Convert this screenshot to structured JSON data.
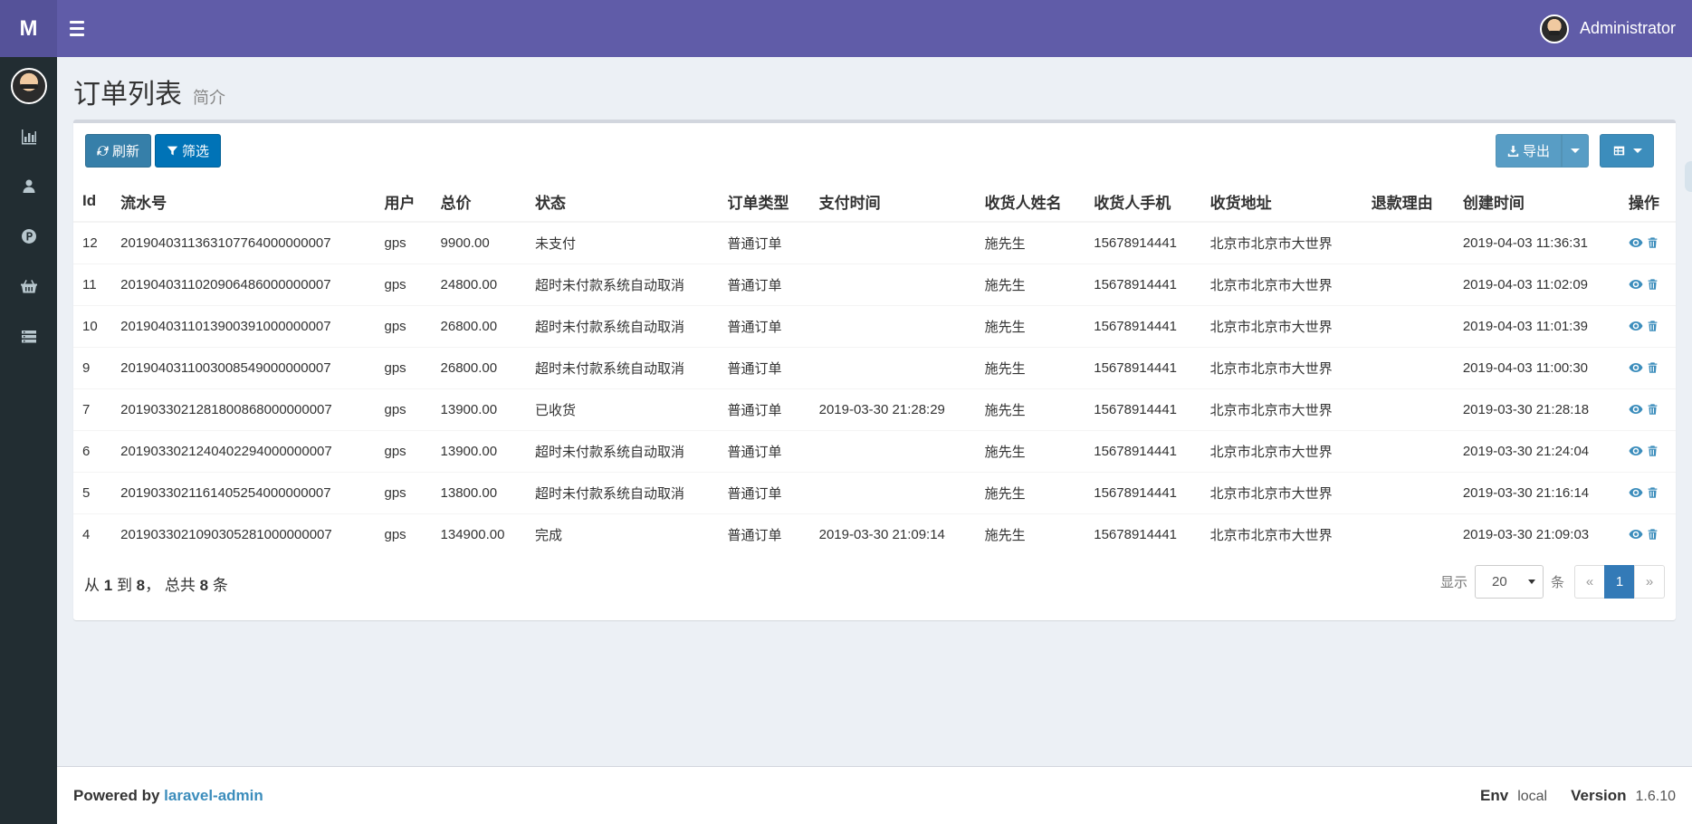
{
  "logo": "M",
  "header": {
    "user_name": "Administrator"
  },
  "page": {
    "title": "订单列表",
    "subtitle": "简介"
  },
  "toolbar": {
    "refresh_label": "刷新",
    "filter_label": "筛选",
    "export_label": "导出"
  },
  "table": {
    "columns": [
      "Id",
      "流水号",
      "用户",
      "总价",
      "状态",
      "订单类型",
      "支付时间",
      "收货人姓名",
      "收货人手机",
      "收货地址",
      "退款理由",
      "创建时间",
      "操作"
    ],
    "rows": [
      [
        "12",
        "2019040311363107764000000007",
        "gps",
        "9900.00",
        "未支付",
        "普通订单",
        "",
        "施先生",
        "15678914441",
        "北京市北京市大世界",
        "",
        "2019-04-03 11:36:31"
      ],
      [
        "11",
        "2019040311020906486000000007",
        "gps",
        "24800.00",
        "超时未付款系统自动取消",
        "普通订单",
        "",
        "施先生",
        "15678914441",
        "北京市北京市大世界",
        "",
        "2019-04-03 11:02:09"
      ],
      [
        "10",
        "2019040311013900391000000007",
        "gps",
        "26800.00",
        "超时未付款系统自动取消",
        "普通订单",
        "",
        "施先生",
        "15678914441",
        "北京市北京市大世界",
        "",
        "2019-04-03 11:01:39"
      ],
      [
        "9",
        "2019040311003008549000000007",
        "gps",
        "26800.00",
        "超时未付款系统自动取消",
        "普通订单",
        "",
        "施先生",
        "15678914441",
        "北京市北京市大世界",
        "",
        "2019-04-03 11:00:30"
      ],
      [
        "7",
        "2019033021281800868000000007",
        "gps",
        "13900.00",
        "已收货",
        "普通订单",
        "2019-03-30 21:28:29",
        "施先生",
        "15678914441",
        "北京市北京市大世界",
        "",
        "2019-03-30 21:28:18"
      ],
      [
        "6",
        "2019033021240402294000000007",
        "gps",
        "13900.00",
        "超时未付款系统自动取消",
        "普通订单",
        "",
        "施先生",
        "15678914441",
        "北京市北京市大世界",
        "",
        "2019-03-30 21:24:04"
      ],
      [
        "5",
        "2019033021161405254000000007",
        "gps",
        "13800.00",
        "超时未付款系统自动取消",
        "普通订单",
        "",
        "施先生",
        "15678914441",
        "北京市北京市大世界",
        "",
        "2019-03-30 21:16:14"
      ],
      [
        "4",
        "2019033021090305281000000007",
        "gps",
        "134900.00",
        "完成",
        "普通订单",
        "2019-03-30 21:09:14",
        "施先生",
        "15678914441",
        "北京市北京市大世界",
        "",
        "2019-03-30 21:09:03"
      ]
    ]
  },
  "summary": {
    "prefix": "从",
    "from": "1",
    "to_word": "到",
    "to": "8",
    "total_word": "，  总共",
    "total": "8",
    "suffix": "条"
  },
  "pagination": {
    "show_label": "显示",
    "per_page": "20",
    "unit_label": "条",
    "prev": "«",
    "current": "1",
    "next": "»"
  },
  "footer": {
    "powered_by": "Powered by",
    "brand": "laravel-admin",
    "env_label": "Env",
    "env_value": "local",
    "version_label": "Version",
    "version_value": "1.6.10"
  },
  "icons": {
    "sidebar": [
      "bar-chart-icon",
      "user-icon",
      "product-icon",
      "basket-icon",
      "list-icon"
    ],
    "row_actions": [
      "eye-icon",
      "trash-icon"
    ]
  },
  "colors": {
    "header": "#605ca8",
    "logo": "#555299",
    "sidebar": "#222d32",
    "accent": "#3c8dbc"
  }
}
